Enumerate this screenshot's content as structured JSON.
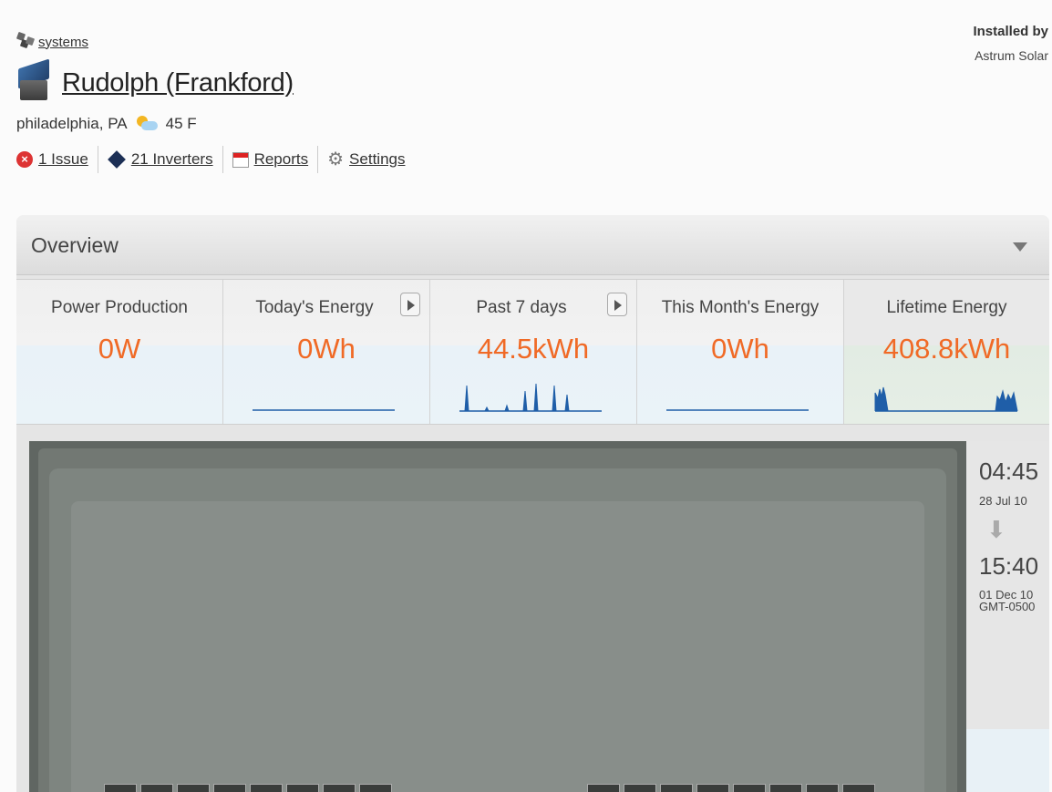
{
  "breadcrumb": {
    "label": "systems"
  },
  "system": {
    "name": "Rudolph (Frankford)",
    "location": "philadelphia, PA",
    "temperature": "45 F"
  },
  "links": {
    "issues": "1 Issue",
    "inverters": "21 Inverters",
    "reports": "Reports",
    "settings": "Settings"
  },
  "installer": {
    "label": "Installed by",
    "name": "Astrum Solar"
  },
  "overview": {
    "title": "Overview",
    "tiles": [
      {
        "label": "Power Production",
        "value": "0W"
      },
      {
        "label": "Today's Energy",
        "value": "0Wh"
      },
      {
        "label": "Past 7 days",
        "value": "44.5kWh"
      },
      {
        "label": "This Month's Energy",
        "value": "0Wh"
      },
      {
        "label": "Lifetime Energy",
        "value": "408.8kWh"
      }
    ]
  },
  "timeline": {
    "start_time": "04:45",
    "start_date": "28 Jul 10",
    "end_time": "15:40",
    "end_date": "01 Dec 10",
    "timezone": "GMT-0500"
  },
  "colors": {
    "value_accent": "#f06a26",
    "sparkline": "#1f5ea8"
  }
}
